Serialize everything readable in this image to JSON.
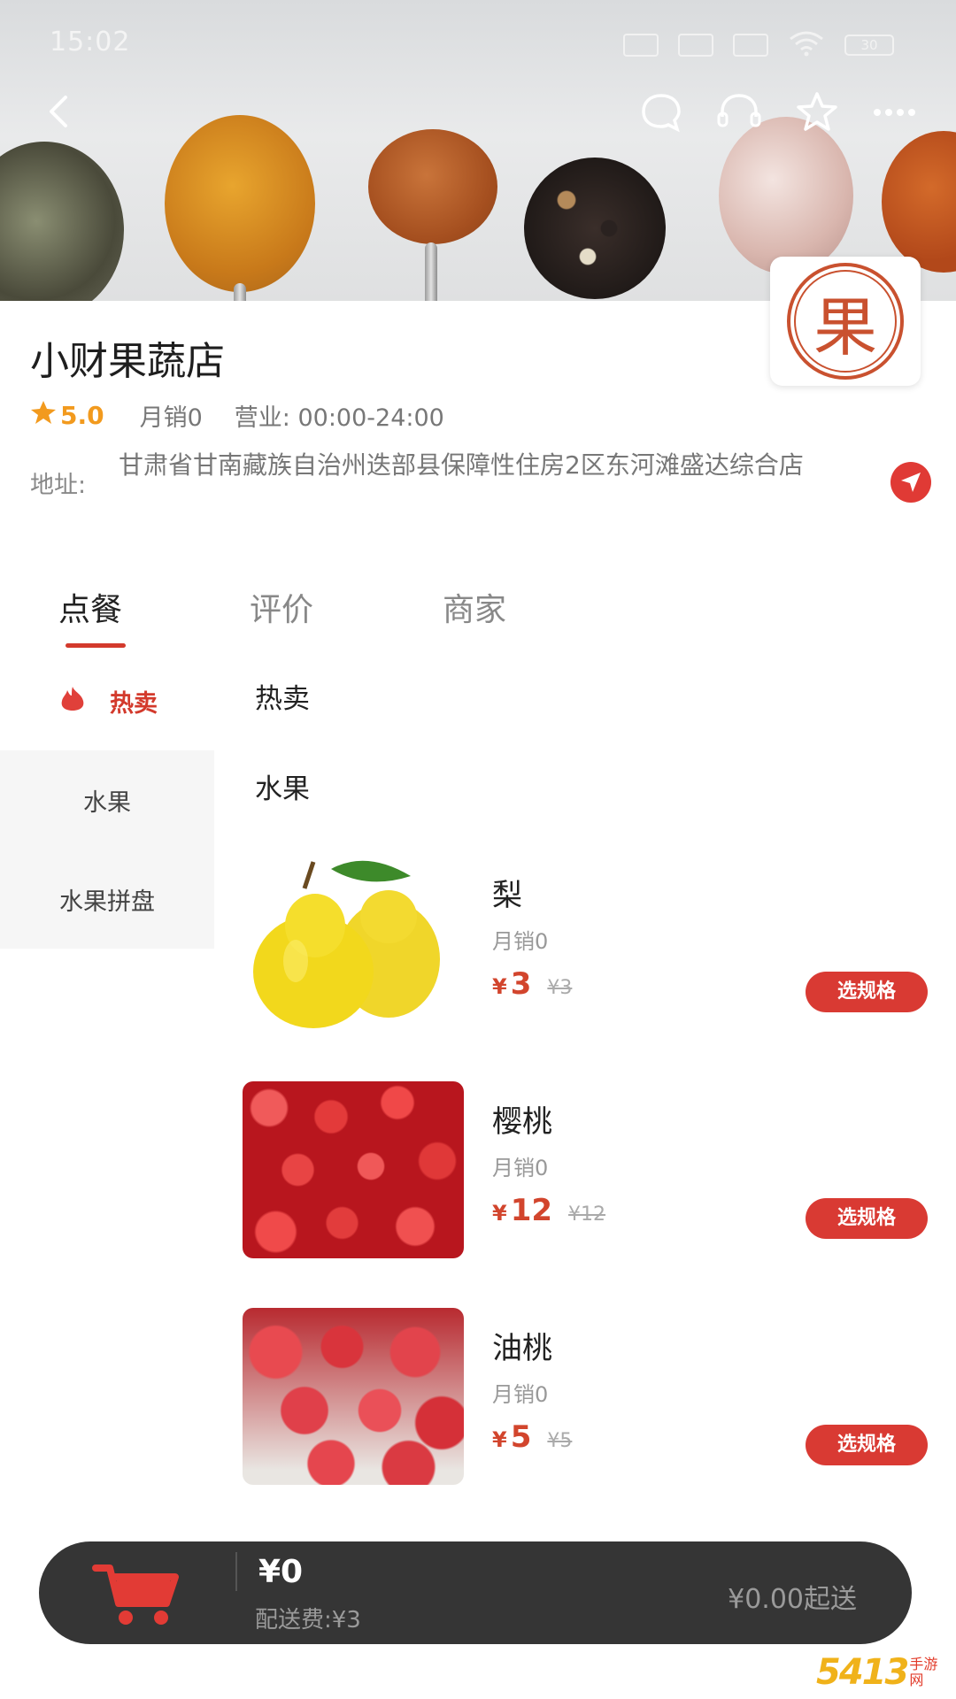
{
  "status_bar": {
    "time": "15:02",
    "battery": "30"
  },
  "shop": {
    "name": "小财果蔬店",
    "rating": "5.0",
    "monthly_sales": "月销0",
    "hours": "营业: 00:00-24:00",
    "address_label": "地址:",
    "address": "甘肃省甘南藏族自治州迭部县保障性住房2区东河滩盛达综合店",
    "logo_char": "果"
  },
  "tabs": [
    {
      "label": "点餐",
      "active": true
    },
    {
      "label": "评价",
      "active": false
    },
    {
      "label": "商家",
      "active": false
    }
  ],
  "categories": [
    {
      "label": "热卖",
      "icon": "fire-icon",
      "selected": true
    },
    {
      "label": "水果",
      "selected": false
    },
    {
      "label": "水果拼盘",
      "selected": false
    }
  ],
  "sections": {
    "hot": "热卖",
    "fruit": "水果"
  },
  "products": [
    {
      "name": "梨",
      "sales": "月销0",
      "currency": "¥",
      "price": "3",
      "original_price": "¥3",
      "button": "选规格"
    },
    {
      "name": "樱桃",
      "sales": "月销0",
      "currency": "¥",
      "price": "12",
      "original_price": "¥12",
      "button": "选规格"
    },
    {
      "name": "油桃",
      "sales": "月销0",
      "currency": "¥",
      "price": "5",
      "original_price": "¥5",
      "button": "选规格"
    }
  ],
  "cart": {
    "total": "¥0",
    "delivery_fee": "配送费:¥3",
    "min_order": "¥0.00起送"
  },
  "watermark": {
    "number": "5413",
    "text": "手游网"
  },
  "colors": {
    "accent": "#d93a33",
    "price": "#d2452d",
    "star": "#f29a1e",
    "cartbar": "#353535"
  }
}
